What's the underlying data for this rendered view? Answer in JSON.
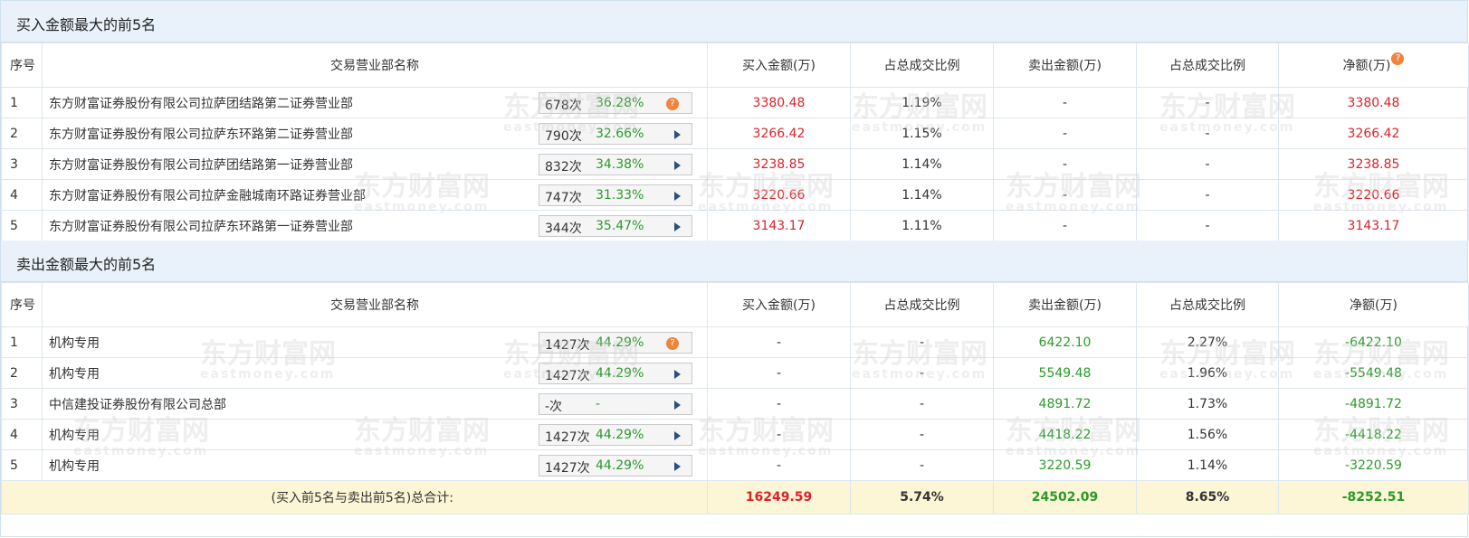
{
  "buy_section": {
    "title": "买入金额最大的前5名",
    "headers": [
      "序号",
      "交易营业部名称",
      "买入金额(万)",
      "占总成交比例",
      "卖出金额(万)",
      "占总成交比例",
      "净额(万)"
    ],
    "rows": [
      {
        "seq": "1",
        "name": "东方财富证券股份有限公司拉萨团结路第二证券营业部",
        "count": "678次",
        "pct": "36.28%",
        "buy": "3380.48",
        "buy_ratio": "1.19%",
        "sell": "-",
        "sell_ratio": "-",
        "net": "3380.48",
        "icon": "question"
      },
      {
        "seq": "2",
        "name": "东方财富证券股份有限公司拉萨东环路第二证券营业部",
        "count": "790次",
        "pct": "32.66%",
        "buy": "3266.42",
        "buy_ratio": "1.15%",
        "sell": "-",
        "sell_ratio": "-",
        "net": "3266.42",
        "icon": "arrow"
      },
      {
        "seq": "3",
        "name": "东方财富证券股份有限公司拉萨团结路第一证券营业部",
        "count": "832次",
        "pct": "34.38%",
        "buy": "3238.85",
        "buy_ratio": "1.14%",
        "sell": "-",
        "sell_ratio": "-",
        "net": "3238.85",
        "icon": "arrow"
      },
      {
        "seq": "4",
        "name": "东方财富证券股份有限公司拉萨金融城南环路证券营业部",
        "count": "747次",
        "pct": "31.33%",
        "buy": "3220.66",
        "buy_ratio": "1.14%",
        "sell": "-",
        "sell_ratio": "-",
        "net": "3220.66",
        "icon": "arrow"
      },
      {
        "seq": "5",
        "name": "东方财富证券股份有限公司拉萨东环路第一证券营业部",
        "count": "344次",
        "pct": "35.47%",
        "buy": "3143.17",
        "buy_ratio": "1.11%",
        "sell": "-",
        "sell_ratio": "-",
        "net": "3143.17",
        "icon": "arrow"
      }
    ]
  },
  "sell_section": {
    "title": "卖出金额最大的前5名",
    "headers": [
      "序号",
      "交易营业部名称",
      "买入金额(万)",
      "占总成交比例",
      "卖出金额(万)",
      "占总成交比例",
      "净额(万)"
    ],
    "rows": [
      {
        "seq": "1",
        "name": "机构专用",
        "count": "1427次",
        "pct": "44.29%",
        "buy": "-",
        "buy_ratio": "-",
        "sell": "6422.10",
        "sell_ratio": "2.27%",
        "net": "-6422.10",
        "icon": "question"
      },
      {
        "seq": "2",
        "name": "机构专用",
        "count": "1427次",
        "pct": "44.29%",
        "buy": "-",
        "buy_ratio": "-",
        "sell": "5549.48",
        "sell_ratio": "1.96%",
        "net": "-5549.48",
        "icon": "arrow"
      },
      {
        "seq": "3",
        "name": "中信建投证券股份有限公司总部",
        "count": "-次",
        "pct": "-",
        "buy": "-",
        "buy_ratio": "-",
        "sell": "4891.72",
        "sell_ratio": "1.73%",
        "net": "-4891.72",
        "icon": "arrow"
      },
      {
        "seq": "4",
        "name": "机构专用",
        "count": "1427次",
        "pct": "44.29%",
        "buy": "-",
        "buy_ratio": "-",
        "sell": "4418.22",
        "sell_ratio": "1.56%",
        "net": "-4418.22",
        "icon": "arrow"
      },
      {
        "seq": "5",
        "name": "机构专用",
        "count": "1427次",
        "pct": "44.29%",
        "buy": "-",
        "buy_ratio": "-",
        "sell": "3220.59",
        "sell_ratio": "1.14%",
        "net": "-3220.59",
        "icon": "arrow"
      }
    ]
  },
  "total": {
    "label": "(买入前5名与卖出前5名)总合计:",
    "buy": "16249.59",
    "buy_ratio": "5.74%",
    "sell": "24502.09",
    "sell_ratio": "8.65%",
    "net": "-8252.51"
  },
  "help_icon_glyph": "?",
  "watermark": {
    "cn": "东方财富网",
    "en": "eastmoney.com"
  },
  "colors": {
    "positive": "#d9232a",
    "negative": "#2a9a2a",
    "header_bg": "#e9f2fa",
    "total_bg": "#fcf5d6"
  }
}
